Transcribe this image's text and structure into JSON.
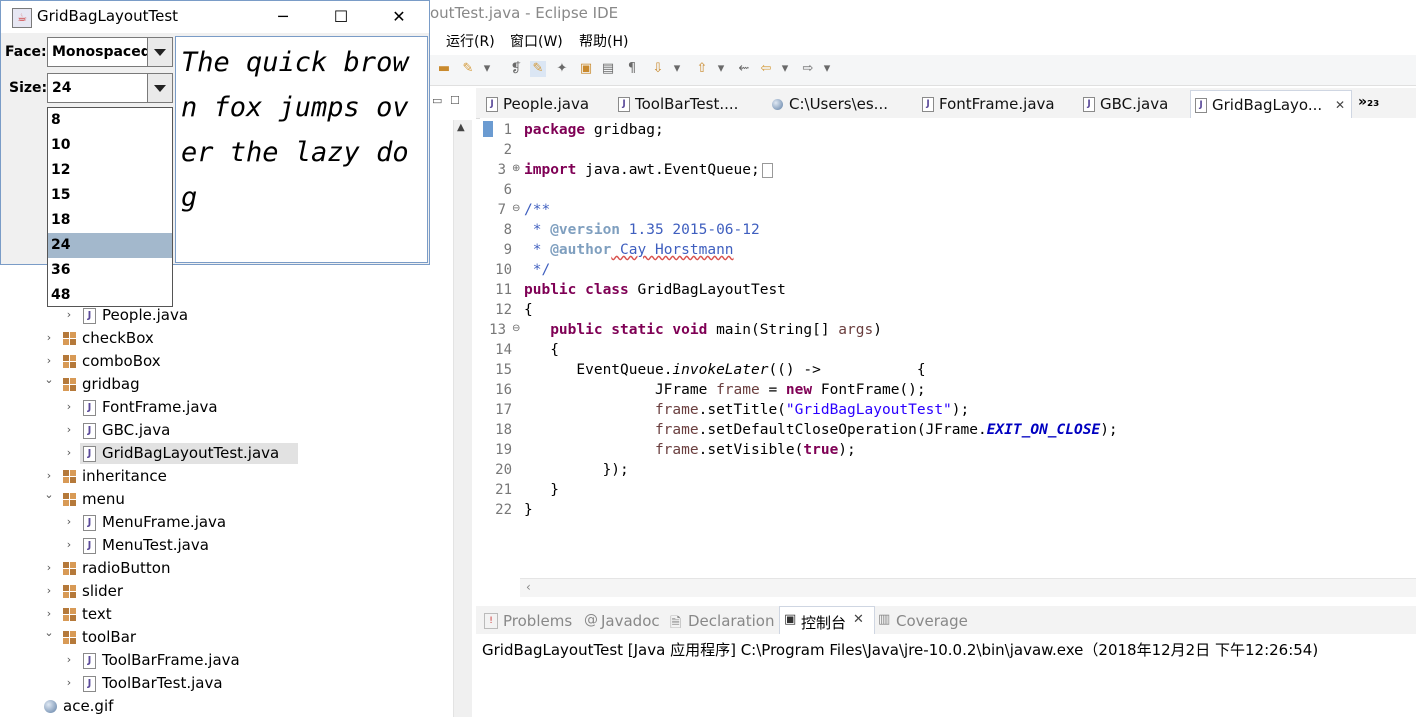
{
  "eclipse": {
    "title": "outTest.java - Eclipse IDE",
    "menu": [
      "运行(R)",
      "窗口(W)",
      "帮助(H)"
    ]
  },
  "tree": [
    {
      "label": "People.java",
      "type": "java",
      "indent": 2,
      "arrow": "right"
    },
    {
      "label": "checkBox",
      "type": "pkg",
      "indent": 1,
      "arrow": "right"
    },
    {
      "label": "comboBox",
      "type": "pkg",
      "indent": 1,
      "arrow": "right"
    },
    {
      "label": "gridbag",
      "type": "pkg",
      "indent": 1,
      "arrow": "down"
    },
    {
      "label": "FontFrame.java",
      "type": "java",
      "indent": 2,
      "arrow": "right"
    },
    {
      "label": "GBC.java",
      "type": "java",
      "indent": 2,
      "arrow": "right"
    },
    {
      "label": "GridBagLayoutTest.java",
      "type": "java",
      "indent": 2,
      "arrow": "right",
      "selected": true
    },
    {
      "label": "inheritance",
      "type": "pkg",
      "indent": 1,
      "arrow": "right"
    },
    {
      "label": "menu",
      "type": "pkg",
      "indent": 1,
      "arrow": "down"
    },
    {
      "label": "MenuFrame.java",
      "type": "java",
      "indent": 2,
      "arrow": "right"
    },
    {
      "label": "MenuTest.java",
      "type": "java",
      "indent": 2,
      "arrow": "right"
    },
    {
      "label": "radioButton",
      "type": "pkg",
      "indent": 1,
      "arrow": "right"
    },
    {
      "label": "slider",
      "type": "pkg",
      "indent": 1,
      "arrow": "right"
    },
    {
      "label": "text",
      "type": "pkg",
      "indent": 1,
      "arrow": "right"
    },
    {
      "label": "toolBar",
      "type": "pkg",
      "indent": 1,
      "arrow": "down"
    },
    {
      "label": "ToolBarFrame.java",
      "type": "java",
      "indent": 2,
      "arrow": "right"
    },
    {
      "label": "ToolBarTest.java",
      "type": "java",
      "indent": 2,
      "arrow": "right"
    },
    {
      "label": "ace.gif",
      "type": "gif",
      "indent": 0,
      "arrow": ""
    }
  ],
  "editor_tabs": [
    {
      "label": "People.java"
    },
    {
      "label": "ToolBarTest...."
    },
    {
      "label": "C:\\Users\\es..."
    },
    {
      "label": "FontFrame.java"
    },
    {
      "label": "GBC.java"
    },
    {
      "label": "GridBagLayo...",
      "active": true
    }
  ],
  "editor_tab_overflow": "»₂₃",
  "code": {
    "line_numbers": [
      "1",
      "2",
      "3",
      "6",
      "7",
      "8",
      "9",
      "10",
      "11",
      "12",
      "13",
      "14",
      "15",
      "16",
      "17",
      "18",
      "19",
      "20",
      "21",
      "22"
    ],
    "l1_kw": "package",
    "l1_rest": " gridbag;",
    "l3_kw": "import",
    "l3_rest": " java.awt.EventQueue;",
    "l7": "/**",
    "l8_tag": "@version",
    "l8_rest": " 1.35 2015-06-12",
    "l9_tag": "@author",
    "l9_rest": " Cay Horstmann",
    "l10": " */",
    "l11_kw": "public class",
    "l11_rest": " GridBagLayoutTest",
    "l12": "{",
    "l13_kw": "public static void",
    "l13_rest": " main(String[] ",
    "l13_var": "args",
    "l13_end": ")",
    "l14": "{",
    "l15_a": "EventQueue.",
    "l15_it": "invokeLater",
    "l15_b": "(() ->           {",
    "l16_a": "JFrame ",
    "l16_var": "frame",
    "l16_b": " = ",
    "l16_kw": "new",
    "l16_c": " FontFrame();",
    "l17_var": "frame",
    "l17_a": ".setTitle(",
    "l17_str": "\"GridBagLayoutTest\"",
    "l17_b": ");",
    "l18_var": "frame",
    "l18_a": ".setDefaultCloseOperation(JFrame.",
    "l18_fld": "EXIT_ON_CLOSE",
    "l18_b": ");",
    "l19_var": "frame",
    "l19_a": ".setVisible(",
    "l19_kw": "true",
    "l19_b": ");",
    "l20": "});",
    "l21": "}",
    "l22": "}"
  },
  "console_tabs": [
    "Problems",
    "Javadoc",
    "Declaration",
    "控制台",
    "Coverage"
  ],
  "console_text": "GridBagLayoutTest [Java 应用程序] C:\\Program Files\\Java\\jre-10.0.2\\bin\\javaw.exe（2018年12月2日 下午12:26:54)",
  "swing": {
    "title": "GridBagLayoutTest",
    "face_label": "Face:",
    "face_value": "Monospaced",
    "size_label": "Size:",
    "size_value": "24",
    "sample_text": "The quick brown fox jumps over the lazy dog",
    "size_options": [
      "8",
      "10",
      "12",
      "15",
      "18",
      "24",
      "36",
      "48"
    ],
    "selected_size": "24"
  }
}
